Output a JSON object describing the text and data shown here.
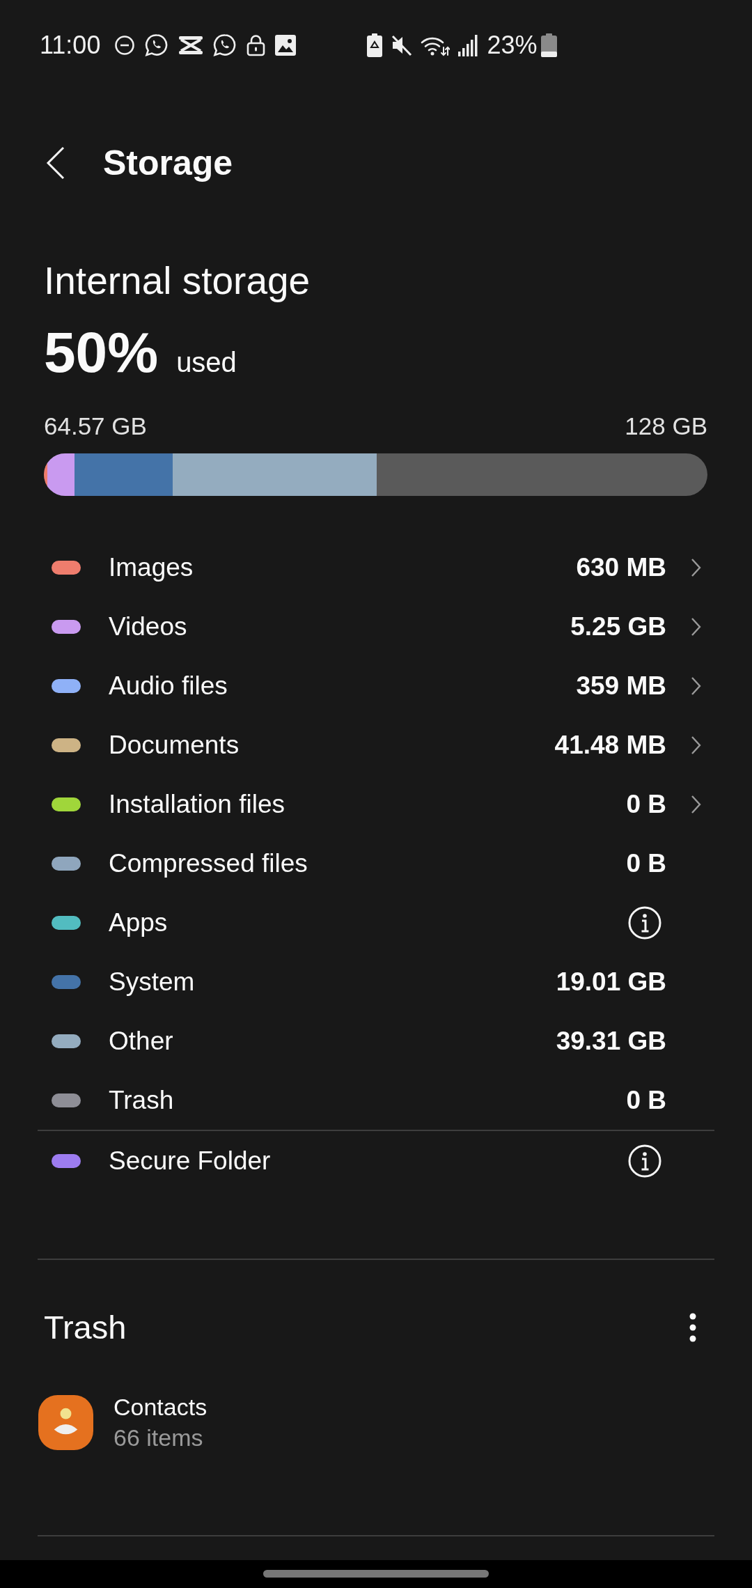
{
  "status_bar": {
    "time": "11:00",
    "battery": "23%"
  },
  "header": {
    "title": "Storage"
  },
  "summary": {
    "title": "Internal storage",
    "percent": "50%",
    "percent_label": "used",
    "used": "64.57 GB",
    "total": "128 GB"
  },
  "category_groups": [
    {
      "items": [
        {
          "name": "Images",
          "size": "630 MB",
          "color": "#ef7d6d",
          "kind": "link",
          "level": 0.005
        },
        {
          "name": "Videos",
          "size": "5.25 GB",
          "color": "#c99af0",
          "kind": "link",
          "level": 0.041
        },
        {
          "name": "Audio files",
          "size": "359 MB",
          "color": "#8fb1f7",
          "kind": "link"
        },
        {
          "name": "Documents",
          "size": "41.48 MB",
          "color": "#cdb385",
          "kind": "link"
        },
        {
          "name": "Installation files",
          "size": "0 B",
          "color": "#a0d63a",
          "kind": "link"
        },
        {
          "name": "Compressed files",
          "size": "0 B",
          "color": "#8fa6bd",
          "kind": "plain"
        },
        {
          "name": "Apps",
          "color": "#52bcc0",
          "kind": "info"
        },
        {
          "name": "System",
          "size": "19.01 GB",
          "color": "#4473a8",
          "kind": "plain",
          "level": 0.1485
        },
        {
          "name": "Other",
          "size": "39.31 GB",
          "color": "#94acbf",
          "kind": "plain",
          "level": 0.307
        },
        {
          "name": "Trash",
          "size": "0 B",
          "color": "#8e8e96",
          "kind": "plain"
        }
      ]
    },
    {
      "items": [
        {
          "name": "Secure Folder",
          "color": "#9d7cf0",
          "kind": "info"
        }
      ]
    }
  ],
  "trash": {
    "title": "Trash",
    "items": [
      {
        "name": "Contacts",
        "count": "66 items"
      }
    ]
  }
}
